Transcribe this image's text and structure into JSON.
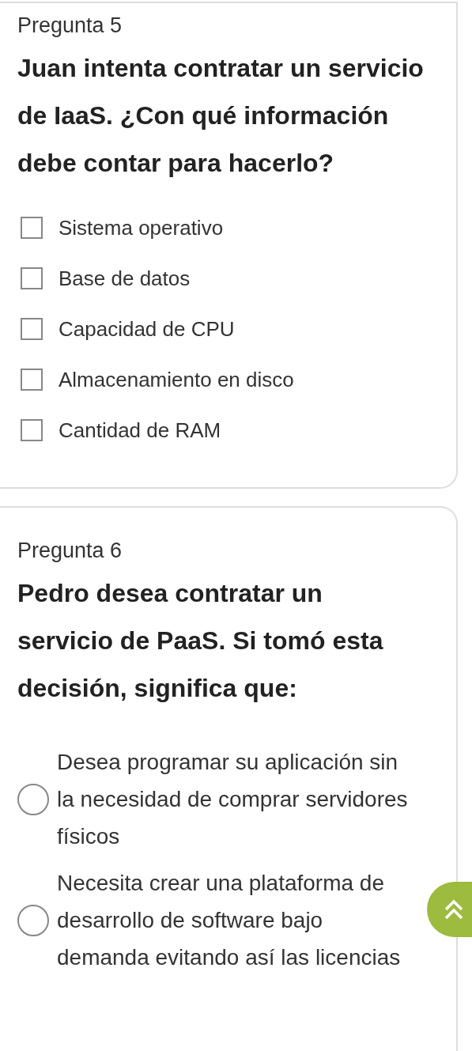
{
  "questions": [
    {
      "title": "Pregunta 5",
      "prompt": "Juan intenta contratar un servicio de IaaS. ¿Con qué información debe contar para hacerlo?",
      "kind": "checkbox",
      "options": [
        {
          "label": "Sistema operativo",
          "checked": false
        },
        {
          "label": "Base de datos",
          "checked": false
        },
        {
          "label": "Capacidad de CPU",
          "checked": false
        },
        {
          "label": "Almacenamiento en disco",
          "checked": false
        },
        {
          "label": "Cantidad de RAM",
          "checked": false
        }
      ]
    },
    {
      "title": "Pregunta 6",
      "prompt": "Pedro desea contratar un servicio de PaaS. Si tomó esta decisión, significa que:",
      "kind": "radio",
      "options": [
        {
          "label": "Desea programar su aplicación sin la necesidad de comprar servidores físicos",
          "selected": false
        },
        {
          "label": "Necesita crear una plataforma de desarrollo de software bajo demanda evitando así las licencias",
          "selected": false
        }
      ]
    }
  ]
}
